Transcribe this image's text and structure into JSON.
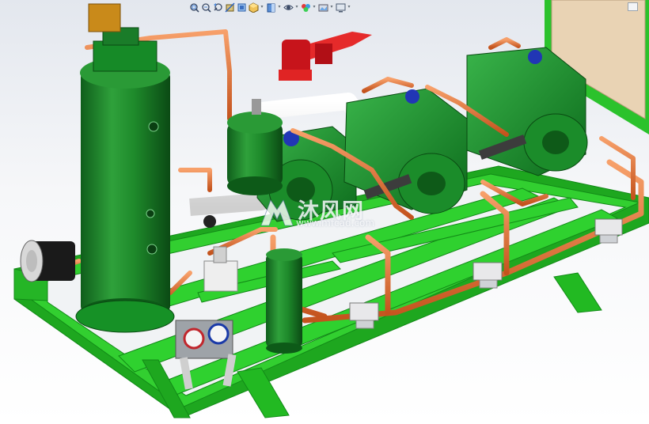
{
  "app": {
    "view": "3D assembly viewport"
  },
  "heads_up_toolbar": {
    "icons": [
      {
        "name": "zoom-to-fit-icon",
        "has_dropdown": false
      },
      {
        "name": "zoom-to-area-icon",
        "has_dropdown": false
      },
      {
        "name": "previous-view-icon",
        "has_dropdown": false
      },
      {
        "name": "section-view-icon",
        "has_dropdown": false
      },
      {
        "name": "dynamic-annotation-icon",
        "has_dropdown": false
      },
      {
        "name": "view-orientation-icon",
        "has_dropdown": true
      },
      {
        "name": "display-style-icon",
        "has_dropdown": true
      },
      {
        "name": "hide-show-items-icon",
        "has_dropdown": true
      },
      {
        "name": "edit-appearance-icon",
        "has_dropdown": true
      },
      {
        "name": "apply-scene-icon",
        "has_dropdown": true
      },
      {
        "name": "view-settings-icon",
        "has_dropdown": true
      }
    ]
  },
  "watermark": {
    "brand": "沐风网",
    "url": "www.mfcad.com"
  },
  "colors": {
    "frame_green": "#27c42b",
    "tank_green": "#1f8f2f",
    "copper": "#e8783a",
    "insulation_white": "#f2f2f2",
    "valve_red": "#d71f1f",
    "panel_beige": "#e9d3b4",
    "cap_blue": "#2136b5"
  }
}
